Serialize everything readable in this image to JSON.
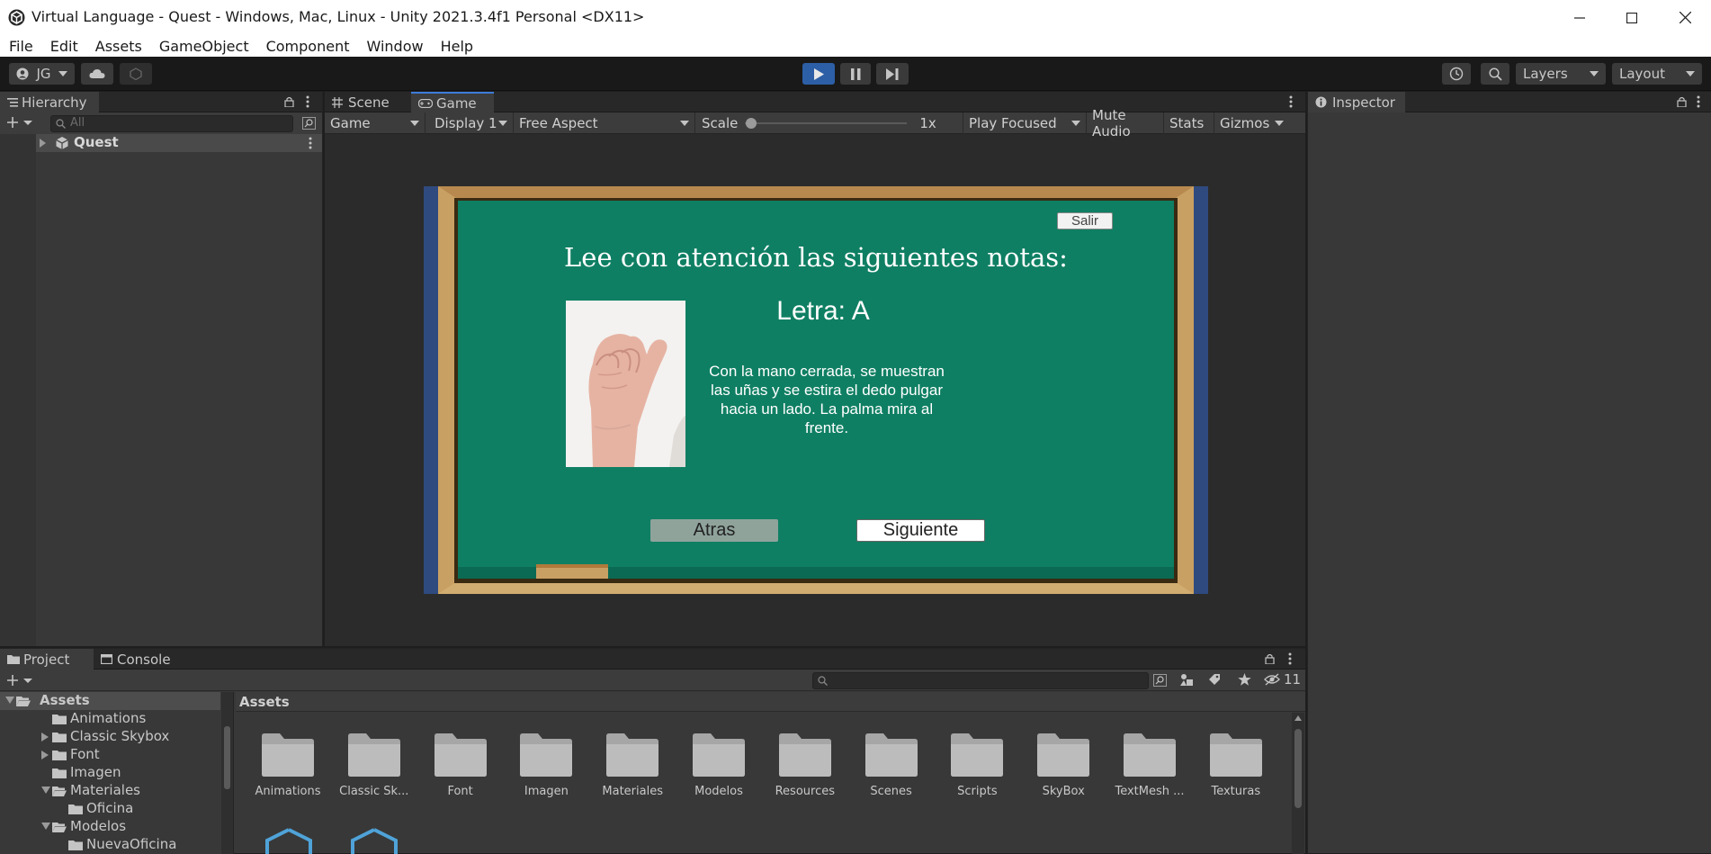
{
  "window": {
    "title": "Virtual Language - Quest - Windows, Mac, Linux - Unity 2021.3.4f1 Personal <DX11>"
  },
  "menu": [
    "File",
    "Edit",
    "Assets",
    "GameObject",
    "Component",
    "Window",
    "Help"
  ],
  "toolbar": {
    "account": "JG",
    "layers": "Layers",
    "layout": "Layout"
  },
  "hierarchy": {
    "tab": "Hierarchy",
    "search_placeholder": "All",
    "scene": "Quest"
  },
  "game_view": {
    "tabs": [
      "Scene",
      "Game"
    ],
    "mode": "Game",
    "display": "Display 1",
    "aspect": "Free Aspect",
    "scale_label": "Scale",
    "scale_value": "1x",
    "play_focused": "Play Focused",
    "mute": "Mute Audio",
    "stats": "Stats",
    "gizmos": "Gizmos"
  },
  "game": {
    "exit_button": "Salir",
    "heading": "Lee con atención las siguientes notas:",
    "letter": "Letra: A",
    "description": "Con la mano cerrada, se muestran las uñas y se estira el dedo pulgar hacia un lado. La palma mira al frente.",
    "back_button": "Atras",
    "next_button": "Siguiente",
    "colors": {
      "board": "#0f7f63",
      "frame": "#c9a063",
      "side": "#2f4a7f"
    }
  },
  "inspector": {
    "tab": "Inspector"
  },
  "project": {
    "tabs": [
      "Project",
      "Console"
    ],
    "breadcrumb": "Assets",
    "hidden_count": "11",
    "tree": [
      {
        "label": "Assets",
        "indent": 0,
        "expanded": true,
        "arrow": true
      },
      {
        "label": "Animations",
        "indent": 1,
        "expanded": false,
        "arrow": false
      },
      {
        "label": "Classic Skybox",
        "indent": 1,
        "expanded": false,
        "arrow": true
      },
      {
        "label": "Font",
        "indent": 1,
        "expanded": false,
        "arrow": true
      },
      {
        "label": "Imagen",
        "indent": 1,
        "expanded": false,
        "arrow": false
      },
      {
        "label": "Materiales",
        "indent": 1,
        "expanded": true,
        "arrow": true
      },
      {
        "label": "Oficina",
        "indent": 2,
        "expanded": false,
        "arrow": false
      },
      {
        "label": "Modelos",
        "indent": 1,
        "expanded": true,
        "arrow": true
      },
      {
        "label": "NuevaOficina",
        "indent": 2,
        "expanded": false,
        "arrow": false
      }
    ],
    "folders": [
      "Animations",
      "Classic Sk...",
      "Font",
      "Imagen",
      "Materiales",
      "Modelos",
      "Resources",
      "Scenes",
      "Scripts",
      "SkyBox",
      "TextMesh ...",
      "Texturas"
    ]
  }
}
